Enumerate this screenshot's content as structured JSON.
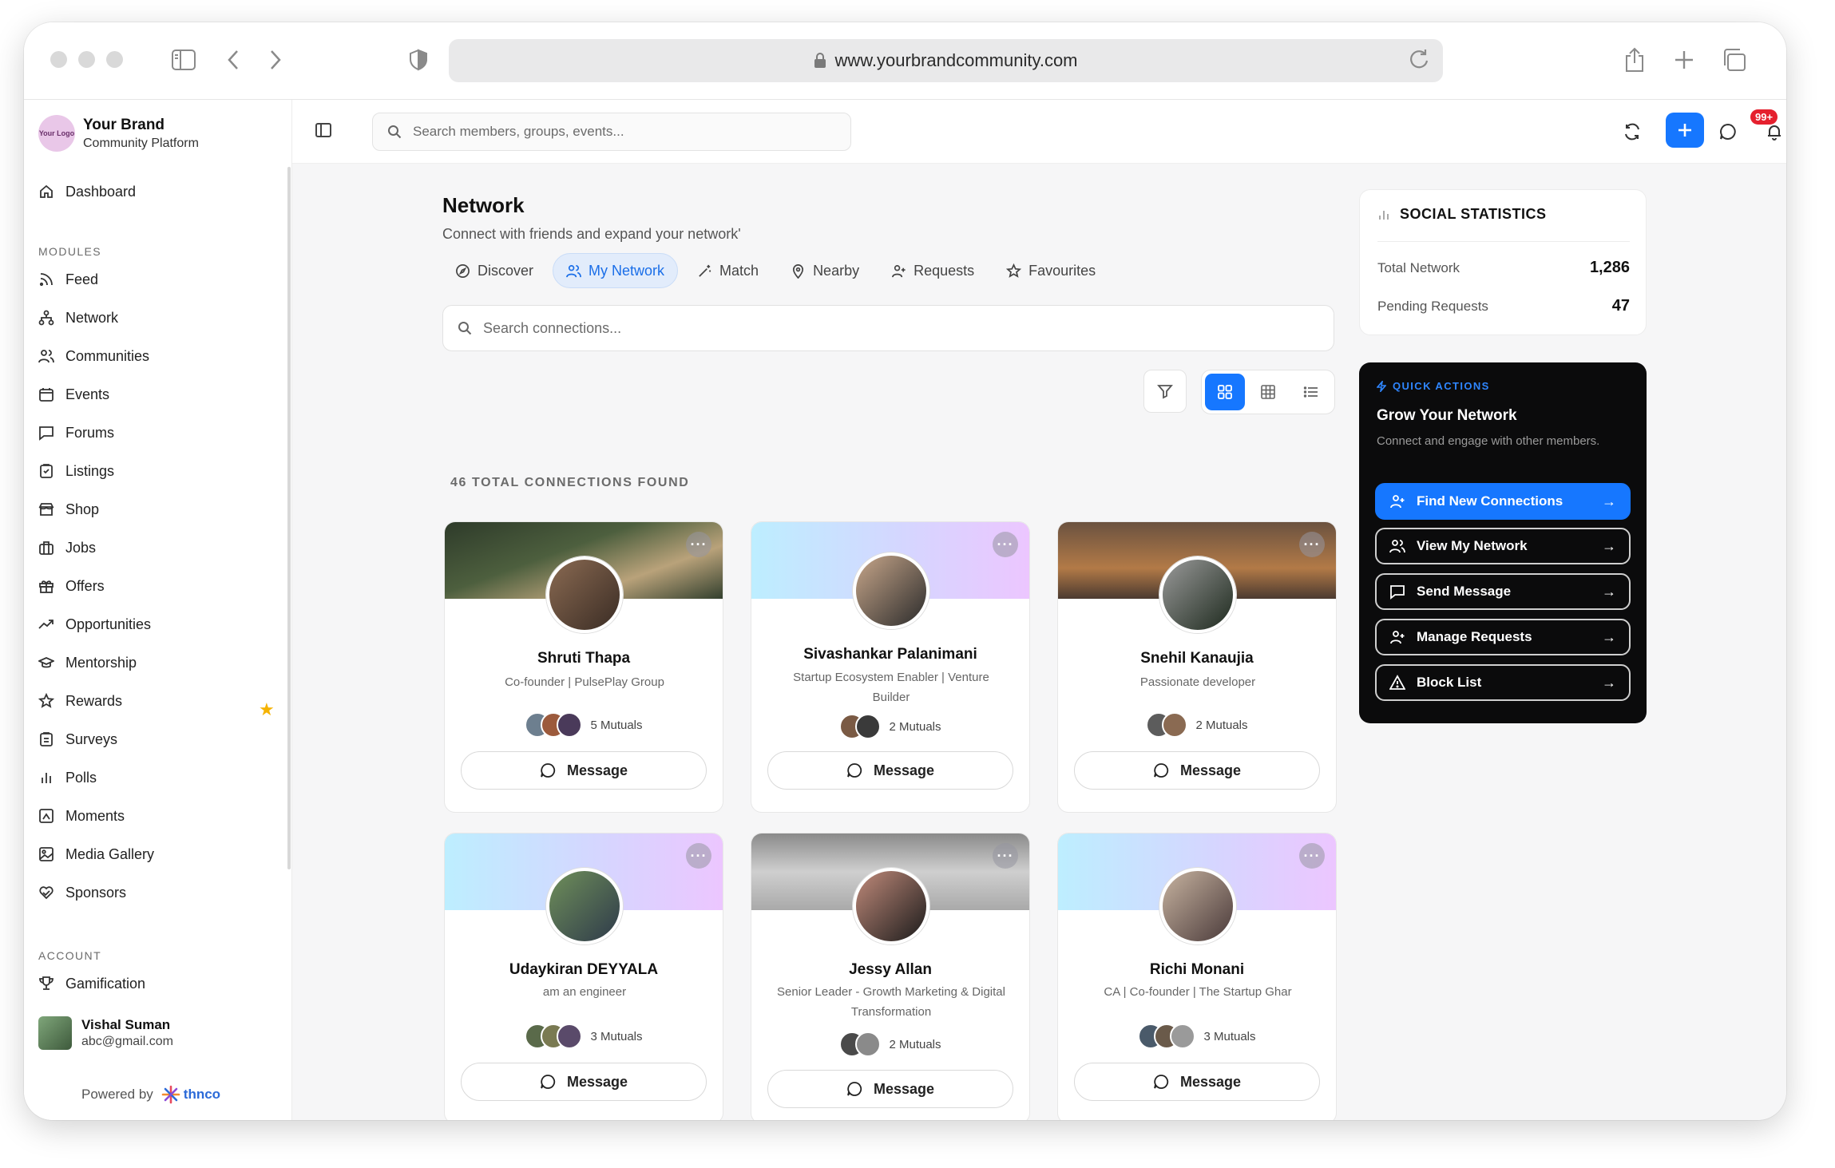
{
  "browser": {
    "url": "www.yourbrandcommunity.com"
  },
  "brand": {
    "logo_text": "Your Logo",
    "name": "Your Brand",
    "subtitle": "Community Platform"
  },
  "sidebar": {
    "dashboard": "Dashboard",
    "modules_heading": "MODULES",
    "modules": [
      "Feed",
      "Network",
      "Communities",
      "Events",
      "Forums",
      "Listings",
      "Shop",
      "Jobs",
      "Offers",
      "Opportunities",
      "Mentorship",
      "Rewards",
      "Surveys",
      "Polls",
      "Moments",
      "Media Gallery",
      "Sponsors"
    ],
    "account_heading": "ACCOUNT",
    "account": [
      "Gamification"
    ],
    "user": {
      "name": "Vishal Suman",
      "email": "abc@gmail.com"
    },
    "powered_by": "Powered by",
    "powered_brand": "thnco"
  },
  "topbar": {
    "search_placeholder": "Search members, groups, events...",
    "badge": "99+"
  },
  "page": {
    "title": "Network",
    "subtitle": "Connect with friends and expand your network'",
    "tabs": [
      "Discover",
      "My Network",
      "Match",
      "Nearby",
      "Requests",
      "Favourites"
    ],
    "active_tab": "My Network",
    "search_placeholder": "Search connections...",
    "count_label": "46 TOTAL CONNECTIONS FOUND"
  },
  "connections": [
    {
      "name": "Shruti Thapa",
      "role": "Co-founder | PulsePlay Group",
      "mutuals": "5 Mutuals",
      "button": "Message"
    },
    {
      "name": "Sivashankar Palanimani",
      "role": "Startup Ecosystem Enabler | Venture Builder",
      "mutuals": "2 Mutuals",
      "button": "Message"
    },
    {
      "name": "Snehil Kanaujia",
      "role": "Passionate developer",
      "mutuals": "2 Mutuals",
      "button": "Message"
    },
    {
      "name": "Udaykiran DEYYALA",
      "role": "am an engineer",
      "mutuals": "3 Mutuals",
      "button": "Message"
    },
    {
      "name": "Jessy Allan",
      "role": "Senior Leader - Growth Marketing & Digital Transformation",
      "mutuals": "2 Mutuals",
      "button": "Message"
    },
    {
      "name": "Richi Monani",
      "role": "CA | Co-founder | The Startup Ghar",
      "mutuals": "3 Mutuals",
      "button": "Message"
    }
  ],
  "stats": {
    "title": "SOCIAL STATISTICS",
    "rows": [
      {
        "label": "Total Network",
        "value": "1,286"
      },
      {
        "label": "Pending Requests",
        "value": "47"
      }
    ]
  },
  "quick_actions": {
    "tag": "QUICK ACTIONS",
    "title": "Grow Your Network",
    "subtitle": "Connect and engage with other members.",
    "buttons": [
      "Find New Connections",
      "View My Network",
      "Send Message",
      "Manage Requests",
      "Block List"
    ]
  },
  "colors": {
    "accent": "#1677ff",
    "badge": "#e5202e",
    "star": "#f5b301",
    "panel_dark": "#0b0b0c"
  }
}
